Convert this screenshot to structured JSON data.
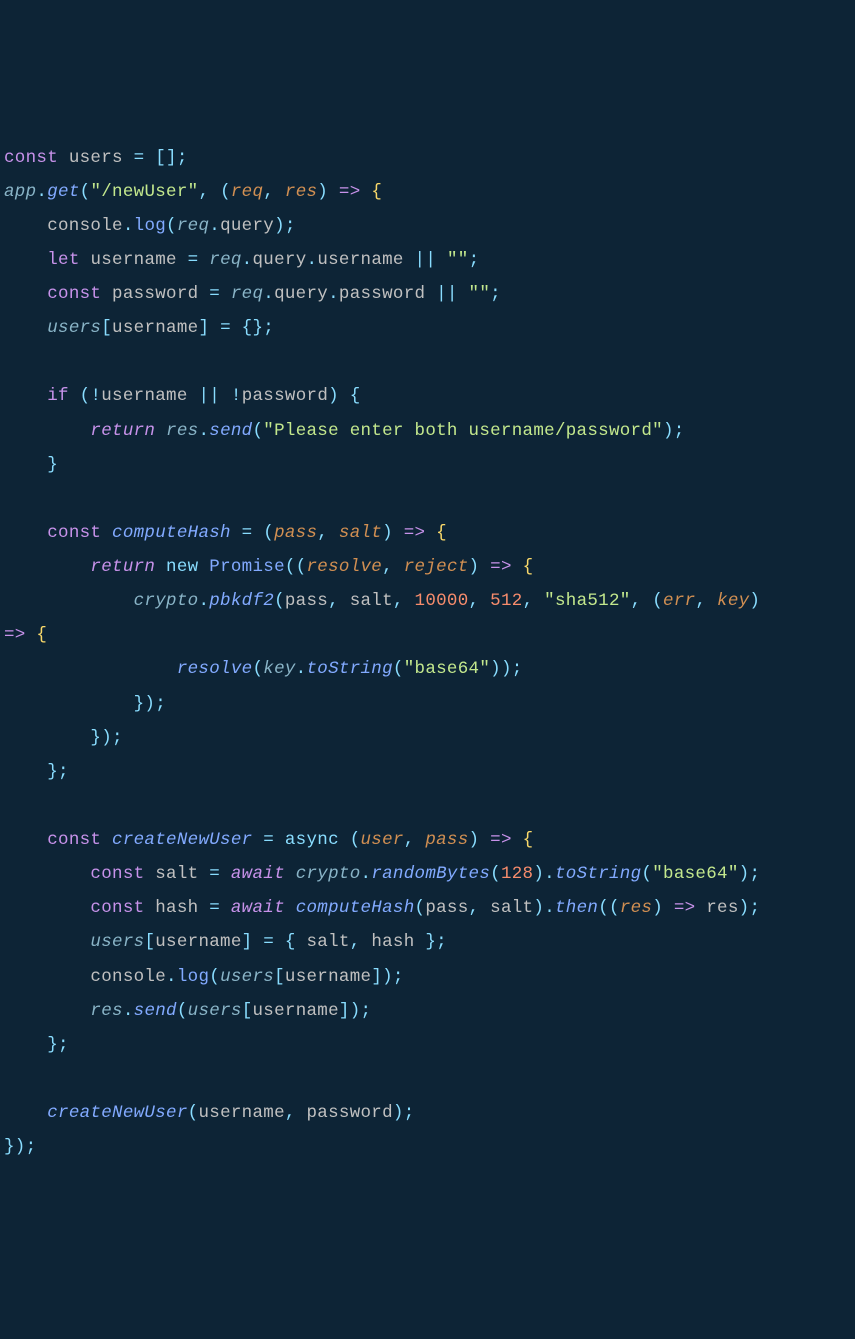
{
  "code": {
    "lines": [
      {
        "id": 0,
        "tokens": [
          {
            "t": "const ",
            "c": "kw"
          },
          {
            "t": "users",
            "c": "var"
          },
          {
            "t": " = []",
            "c": "op"
          },
          {
            "t": ";",
            "c": "semi"
          }
        ]
      },
      {
        "id": 1,
        "tokens": [
          {
            "t": "app",
            "c": "obj-ital"
          },
          {
            "t": ".",
            "c": "op"
          },
          {
            "t": "get",
            "c": "fn-ital"
          },
          {
            "t": "(",
            "c": "punc"
          },
          {
            "t": "\"/newUser\"",
            "c": "str"
          },
          {
            "t": ", (",
            "c": "punc"
          },
          {
            "t": "req",
            "c": "param"
          },
          {
            "t": ", ",
            "c": "punc"
          },
          {
            "t": "res",
            "c": "param"
          },
          {
            "t": ") ",
            "c": "punc"
          },
          {
            "t": "=>",
            "c": "kw"
          },
          {
            "t": " {",
            "c": "brace"
          }
        ]
      },
      {
        "id": 2,
        "tokens": [
          {
            "t": "    console",
            "c": "var"
          },
          {
            "t": ".",
            "c": "op"
          },
          {
            "t": "log",
            "c": "fn"
          },
          {
            "t": "(",
            "c": "punc"
          },
          {
            "t": "req",
            "c": "obj-ital"
          },
          {
            "t": ".",
            "c": "op"
          },
          {
            "t": "query",
            "c": "prop"
          },
          {
            "t": ")",
            "c": "punc"
          },
          {
            "t": ";",
            "c": "semi"
          }
        ]
      },
      {
        "id": 3,
        "tokens": [
          {
            "t": "    ",
            "c": ""
          },
          {
            "t": "let ",
            "c": "kw"
          },
          {
            "t": "username",
            "c": "var"
          },
          {
            "t": " = ",
            "c": "op"
          },
          {
            "t": "req",
            "c": "obj-ital"
          },
          {
            "t": ".",
            "c": "op"
          },
          {
            "t": "query",
            "c": "prop"
          },
          {
            "t": ".",
            "c": "op"
          },
          {
            "t": "username",
            "c": "prop"
          },
          {
            "t": " || ",
            "c": "op"
          },
          {
            "t": "\"\"",
            "c": "str"
          },
          {
            "t": ";",
            "c": "semi"
          }
        ]
      },
      {
        "id": 4,
        "tokens": [
          {
            "t": "    ",
            "c": ""
          },
          {
            "t": "const ",
            "c": "kw"
          },
          {
            "t": "password",
            "c": "var"
          },
          {
            "t": " = ",
            "c": "op"
          },
          {
            "t": "req",
            "c": "obj-ital"
          },
          {
            "t": ".",
            "c": "op"
          },
          {
            "t": "query",
            "c": "prop"
          },
          {
            "t": ".",
            "c": "op"
          },
          {
            "t": "password",
            "c": "prop"
          },
          {
            "t": " || ",
            "c": "op"
          },
          {
            "t": "\"\"",
            "c": "str"
          },
          {
            "t": ";",
            "c": "semi"
          }
        ]
      },
      {
        "id": 5,
        "tokens": [
          {
            "t": "    ",
            "c": ""
          },
          {
            "t": "users",
            "c": "obj-ital"
          },
          {
            "t": "[",
            "c": "punc"
          },
          {
            "t": "username",
            "c": "var"
          },
          {
            "t": "] = {}",
            "c": "op"
          },
          {
            "t": ";",
            "c": "semi"
          }
        ]
      },
      {
        "id": 6,
        "tokens": [
          {
            "t": " ",
            "c": ""
          }
        ]
      },
      {
        "id": 7,
        "tokens": [
          {
            "t": "    ",
            "c": ""
          },
          {
            "t": "if ",
            "c": "kw"
          },
          {
            "t": "(",
            "c": "punc"
          },
          {
            "t": "!",
            "c": "op"
          },
          {
            "t": "username",
            "c": "var"
          },
          {
            "t": " || ",
            "c": "op"
          },
          {
            "t": "!",
            "c": "op"
          },
          {
            "t": "password",
            "c": "var"
          },
          {
            "t": ") {",
            "c": "punc"
          }
        ]
      },
      {
        "id": 8,
        "tokens": [
          {
            "t": "        ",
            "c": ""
          },
          {
            "t": "return",
            "c": "kw-ret"
          },
          {
            "t": " ",
            "c": ""
          },
          {
            "t": "res",
            "c": "obj-ital"
          },
          {
            "t": ".",
            "c": "op"
          },
          {
            "t": "send",
            "c": "fn-ital"
          },
          {
            "t": "(",
            "c": "punc"
          },
          {
            "t": "\"Please enter both username/password\"",
            "c": "str"
          },
          {
            "t": ")",
            "c": "punc"
          },
          {
            "t": ";",
            "c": "semi"
          }
        ]
      },
      {
        "id": 9,
        "tokens": [
          {
            "t": "    }",
            "c": "punc"
          }
        ]
      },
      {
        "id": 10,
        "tokens": [
          {
            "t": " ",
            "c": ""
          }
        ]
      },
      {
        "id": 11,
        "tokens": [
          {
            "t": "    ",
            "c": ""
          },
          {
            "t": "const ",
            "c": "kw"
          },
          {
            "t": "computeHash",
            "c": "fn-ital"
          },
          {
            "t": " = (",
            "c": "op"
          },
          {
            "t": "pass",
            "c": "param"
          },
          {
            "t": ", ",
            "c": "punc"
          },
          {
            "t": "salt",
            "c": "param"
          },
          {
            "t": ") ",
            "c": "punc"
          },
          {
            "t": "=>",
            "c": "kw"
          },
          {
            "t": " {",
            "c": "brace"
          }
        ]
      },
      {
        "id": 12,
        "tokens": [
          {
            "t": "        ",
            "c": ""
          },
          {
            "t": "return",
            "c": "kw-ret"
          },
          {
            "t": " ",
            "c": ""
          },
          {
            "t": "new",
            "c": "new-kw"
          },
          {
            "t": " ",
            "c": ""
          },
          {
            "t": "Promise",
            "c": "fn"
          },
          {
            "t": "((",
            "c": "punc"
          },
          {
            "t": "resolve",
            "c": "param"
          },
          {
            "t": ", ",
            "c": "punc"
          },
          {
            "t": "reject",
            "c": "param"
          },
          {
            "t": ") ",
            "c": "punc"
          },
          {
            "t": "=>",
            "c": "kw"
          },
          {
            "t": " {",
            "c": "brace"
          }
        ]
      },
      {
        "id": 13,
        "tokens": [
          {
            "t": "            ",
            "c": ""
          },
          {
            "t": "crypto",
            "c": "obj-ital"
          },
          {
            "t": ".",
            "c": "op"
          },
          {
            "t": "pbkdf2",
            "c": "fn-ital"
          },
          {
            "t": "(",
            "c": "punc"
          },
          {
            "t": "pass",
            "c": "var"
          },
          {
            "t": ", ",
            "c": "punc"
          },
          {
            "t": "salt",
            "c": "var"
          },
          {
            "t": ", ",
            "c": "punc"
          },
          {
            "t": "10000",
            "c": "num"
          },
          {
            "t": ", ",
            "c": "punc"
          },
          {
            "t": "512",
            "c": "num"
          },
          {
            "t": ", ",
            "c": "punc"
          },
          {
            "t": "\"sha512\"",
            "c": "str"
          },
          {
            "t": ", (",
            "c": "punc"
          },
          {
            "t": "err",
            "c": "param"
          },
          {
            "t": ", ",
            "c": "punc"
          },
          {
            "t": "key",
            "c": "param"
          },
          {
            "t": ") ",
            "c": "punc"
          }
        ]
      },
      {
        "id": 13.5,
        "tokens": [
          {
            "t": "=>",
            "c": "kw"
          },
          {
            "t": " {",
            "c": "brace"
          }
        ]
      },
      {
        "id": 14,
        "tokens": [
          {
            "t": "                ",
            "c": ""
          },
          {
            "t": "resolve",
            "c": "fn-ital"
          },
          {
            "t": "(",
            "c": "punc"
          },
          {
            "t": "key",
            "c": "obj-ital"
          },
          {
            "t": ".",
            "c": "op"
          },
          {
            "t": "toString",
            "c": "fn-ital"
          },
          {
            "t": "(",
            "c": "punc"
          },
          {
            "t": "\"base64\"",
            "c": "str"
          },
          {
            "t": "))",
            "c": "punc"
          },
          {
            "t": ";",
            "c": "semi"
          }
        ]
      },
      {
        "id": 15,
        "tokens": [
          {
            "t": "            })",
            "c": "punc"
          },
          {
            "t": ";",
            "c": "semi"
          }
        ]
      },
      {
        "id": 16,
        "tokens": [
          {
            "t": "        })",
            "c": "punc"
          },
          {
            "t": ";",
            "c": "semi"
          }
        ]
      },
      {
        "id": 17,
        "tokens": [
          {
            "t": "    }",
            "c": "punc"
          },
          {
            "t": ";",
            "c": "semi"
          }
        ]
      },
      {
        "id": 18,
        "tokens": [
          {
            "t": " ",
            "c": ""
          }
        ]
      },
      {
        "id": 19,
        "tokens": [
          {
            "t": "    ",
            "c": ""
          },
          {
            "t": "const ",
            "c": "kw"
          },
          {
            "t": "createNewUser",
            "c": "fn-ital"
          },
          {
            "t": " = ",
            "c": "op"
          },
          {
            "t": "async",
            "c": "async"
          },
          {
            "t": " (",
            "c": "punc"
          },
          {
            "t": "user",
            "c": "param"
          },
          {
            "t": ", ",
            "c": "punc"
          },
          {
            "t": "pass",
            "c": "param"
          },
          {
            "t": ") ",
            "c": "punc"
          },
          {
            "t": "=>",
            "c": "kw"
          },
          {
            "t": " {",
            "c": "brace"
          }
        ]
      },
      {
        "id": 20,
        "tokens": [
          {
            "t": "        ",
            "c": ""
          },
          {
            "t": "const ",
            "c": "kw"
          },
          {
            "t": "salt",
            "c": "var"
          },
          {
            "t": " = ",
            "c": "op"
          },
          {
            "t": "await",
            "c": "await"
          },
          {
            "t": " ",
            "c": ""
          },
          {
            "t": "crypto",
            "c": "obj-ital"
          },
          {
            "t": ".",
            "c": "op"
          },
          {
            "t": "randomBytes",
            "c": "fn-ital"
          },
          {
            "t": "(",
            "c": "punc"
          },
          {
            "t": "128",
            "c": "num"
          },
          {
            "t": ")",
            "c": "punc"
          },
          {
            "t": ".",
            "c": "op"
          },
          {
            "t": "toString",
            "c": "fn-ital"
          },
          {
            "t": "(",
            "c": "punc"
          },
          {
            "t": "\"base64\"",
            "c": "str"
          },
          {
            "t": ")",
            "c": "punc"
          },
          {
            "t": ";",
            "c": "semi"
          }
        ]
      },
      {
        "id": 21,
        "tokens": [
          {
            "t": "        ",
            "c": ""
          },
          {
            "t": "const ",
            "c": "kw"
          },
          {
            "t": "hash",
            "c": "var"
          },
          {
            "t": " = ",
            "c": "op"
          },
          {
            "t": "await",
            "c": "await"
          },
          {
            "t": " ",
            "c": ""
          },
          {
            "t": "computeHash",
            "c": "fn-ital"
          },
          {
            "t": "(",
            "c": "punc"
          },
          {
            "t": "pass",
            "c": "var"
          },
          {
            "t": ", ",
            "c": "punc"
          },
          {
            "t": "salt",
            "c": "var"
          },
          {
            "t": ")",
            "c": "punc"
          },
          {
            "t": ".",
            "c": "op"
          },
          {
            "t": "then",
            "c": "fn-ital"
          },
          {
            "t": "((",
            "c": "punc"
          },
          {
            "t": "res",
            "c": "param"
          },
          {
            "t": ") ",
            "c": "punc"
          },
          {
            "t": "=>",
            "c": "kw"
          },
          {
            "t": " res",
            "c": "var"
          },
          {
            "t": ")",
            "c": "punc"
          },
          {
            "t": ";",
            "c": "semi"
          }
        ]
      },
      {
        "id": 22,
        "tokens": [
          {
            "t": "        ",
            "c": ""
          },
          {
            "t": "users",
            "c": "obj-ital"
          },
          {
            "t": "[",
            "c": "punc"
          },
          {
            "t": "username",
            "c": "var"
          },
          {
            "t": "] = { ",
            "c": "op"
          },
          {
            "t": "salt",
            "c": "var"
          },
          {
            "t": ", ",
            "c": "punc"
          },
          {
            "t": "hash",
            "c": "var"
          },
          {
            "t": " }",
            "c": "op"
          },
          {
            "t": ";",
            "c": "semi"
          }
        ]
      },
      {
        "id": 23,
        "tokens": [
          {
            "t": "        console",
            "c": "var"
          },
          {
            "t": ".",
            "c": "op"
          },
          {
            "t": "log",
            "c": "fn"
          },
          {
            "t": "(",
            "c": "punc"
          },
          {
            "t": "users",
            "c": "obj-ital"
          },
          {
            "t": "[",
            "c": "punc"
          },
          {
            "t": "username",
            "c": "var"
          },
          {
            "t": "])",
            "c": "punc"
          },
          {
            "t": ";",
            "c": "semi"
          }
        ]
      },
      {
        "id": 24,
        "tokens": [
          {
            "t": "        ",
            "c": ""
          },
          {
            "t": "res",
            "c": "obj-ital"
          },
          {
            "t": ".",
            "c": "op"
          },
          {
            "t": "send",
            "c": "fn-ital"
          },
          {
            "t": "(",
            "c": "punc"
          },
          {
            "t": "users",
            "c": "obj-ital"
          },
          {
            "t": "[",
            "c": "punc"
          },
          {
            "t": "username",
            "c": "var"
          },
          {
            "t": "])",
            "c": "punc"
          },
          {
            "t": ";",
            "c": "semi"
          }
        ]
      },
      {
        "id": 25,
        "tokens": [
          {
            "t": "    }",
            "c": "punc"
          },
          {
            "t": ";",
            "c": "semi"
          }
        ]
      },
      {
        "id": 26,
        "tokens": [
          {
            "t": " ",
            "c": ""
          }
        ]
      },
      {
        "id": 27,
        "tokens": [
          {
            "t": "    ",
            "c": ""
          },
          {
            "t": "createNewUser",
            "c": "fn-ital"
          },
          {
            "t": "(",
            "c": "punc"
          },
          {
            "t": "username",
            "c": "var"
          },
          {
            "t": ", ",
            "c": "punc"
          },
          {
            "t": "password",
            "c": "var"
          },
          {
            "t": ")",
            "c": "punc"
          },
          {
            "t": ";",
            "c": "semi"
          }
        ]
      },
      {
        "id": 28,
        "tokens": [
          {
            "t": "})",
            "c": "punc"
          },
          {
            "t": ";",
            "c": "semi"
          }
        ]
      }
    ]
  }
}
